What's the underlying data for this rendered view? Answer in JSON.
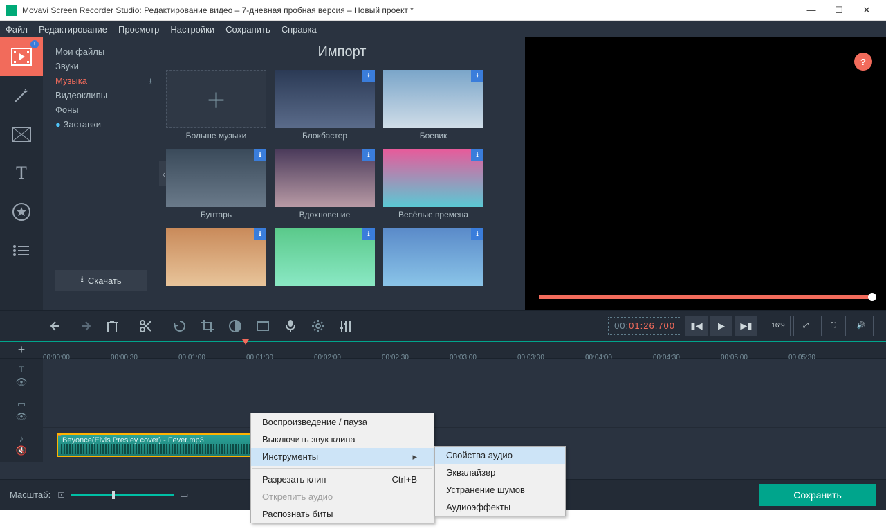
{
  "window": {
    "title": "Movavi Screen Recorder Studio: Редактирование видео – 7-дневная пробная версия – Новый проект *"
  },
  "menu": {
    "file": "Файл",
    "edit": "Редактирование",
    "view": "Просмотр",
    "settings": "Настройки",
    "save": "Сохранить",
    "help": "Справка"
  },
  "import": {
    "title": "Импорт",
    "cats": {
      "my_files": "Мои файлы",
      "sounds": "Звуки",
      "music": "Музыка",
      "videoclips": "Видеоклипы",
      "backgrounds": "Фоны",
      "intros": "Заставки"
    },
    "download": "Скачать",
    "thumbs": [
      {
        "label": "Больше музыки",
        "more": true
      },
      {
        "label": "Блокбастер"
      },
      {
        "label": "Боевик"
      },
      {
        "label": "Бунтарь"
      },
      {
        "label": "Вдохновение"
      },
      {
        "label": "Весёлые времена"
      }
    ]
  },
  "timecode": {
    "gray1": "00:",
    "orange": "01:26.700"
  },
  "aspect": "16:9",
  "ruler": [
    "00:00:00",
    "00:00:30",
    "00:01:00",
    "00:01:30",
    "00:02:00",
    "00:02:30",
    "00:03:00",
    "00:03:30",
    "00:04:00",
    "00:04:30",
    "00:05:00",
    "00:05:30"
  ],
  "clip": {
    "name": "Beyonce(Elvis Presley cover) - Fever.mp3"
  },
  "context": {
    "play_pause": "Воспроизведение / пауза",
    "mute_clip": "Выключить звук клипа",
    "tools": "Инструменты",
    "cut_clip": "Разрезать клип",
    "cut_shortcut": "Ctrl+B",
    "detach_audio": "Открепить аудио",
    "detect_beats": "Распознать биты"
  },
  "submenu": {
    "audio_props": "Свойства аудио",
    "equalizer": "Эквалайзер",
    "noise_removal": "Устранение шумов",
    "audio_effects": "Аудиоэффекты"
  },
  "bottom": {
    "zoom_label": "Масштаб:",
    "save": "Сохранить"
  }
}
